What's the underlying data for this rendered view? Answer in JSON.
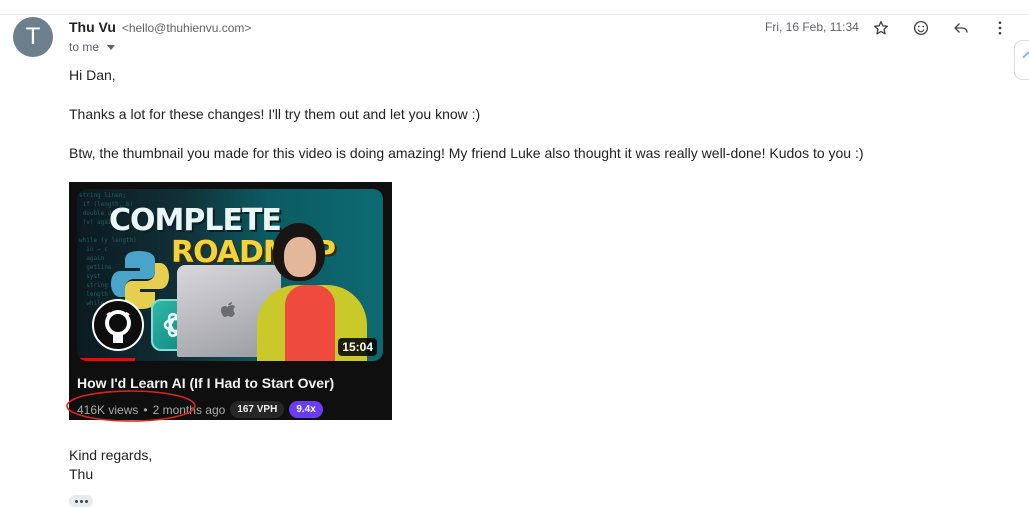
{
  "sender": {
    "avatar_letter": "T",
    "name": "Thu Vu",
    "email": "<hello@thuhienvu.com>",
    "recipient": "to me"
  },
  "header": {
    "date": "Fri, 16 Feb, 11:34",
    "icons": [
      "star-icon",
      "emoji-icon",
      "reply-icon",
      "more-vert-icon"
    ]
  },
  "message": {
    "greeting": "Hi Dan,",
    "line1": "Thanks a lot for these changes! I'll try them out and let you know :)",
    "line2": "Btw, the thumbnail you made for this video is doing amazing! My friend Luke also thought it was really well-done! Kudos to you :)",
    "closing": "Kind regards,",
    "signature": "Thu"
  },
  "video": {
    "thumb_line1": "COMPLETE",
    "thumb_line2": "ROADMAP",
    "duration": "15:04",
    "title": "How I'd Learn AI (If I Had to Start Over)",
    "views": "416K views",
    "separator": "•",
    "age": "2 months ago",
    "vph": "167 VPH",
    "multiplier": "9.4x",
    "progress_fraction": 0.19,
    "colors": {
      "vph_chip": "#272727",
      "multiplier_chip": "#6c3cf5",
      "annotation_circle": "#d9261c"
    }
  }
}
